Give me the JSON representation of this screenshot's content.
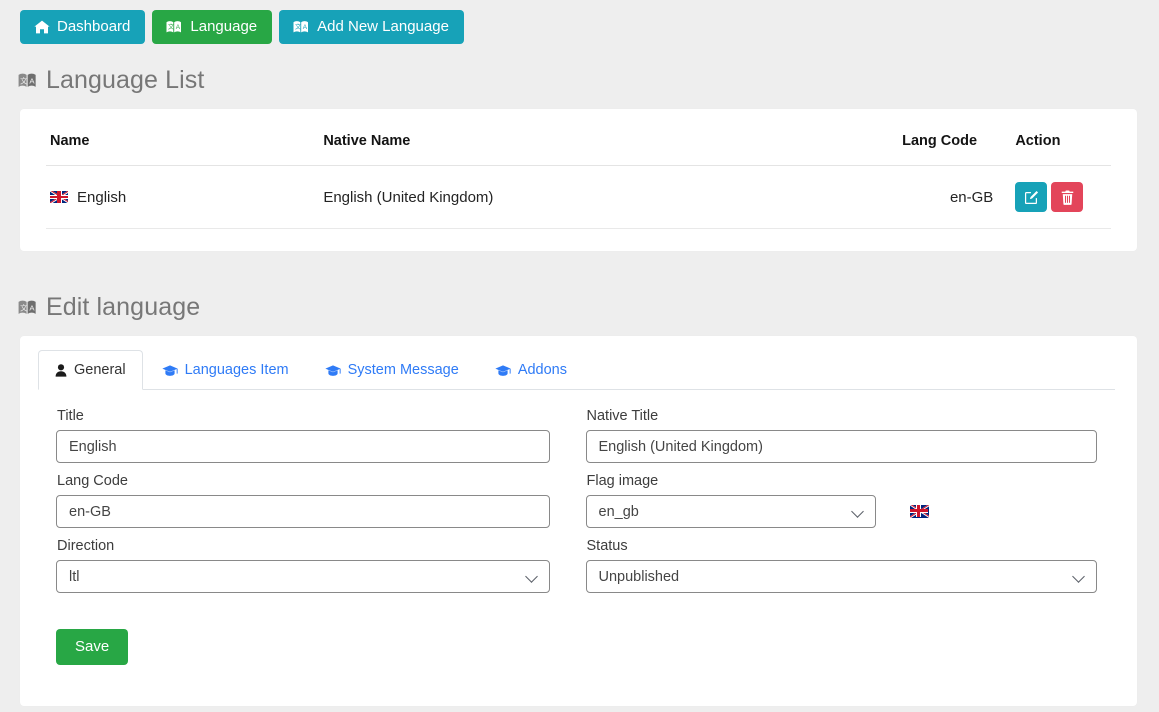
{
  "toolbar": {
    "buttons": [
      {
        "label": "Dashboard",
        "icon": "home-icon",
        "style": "info"
      },
      {
        "label": "Language",
        "icon": "language-book-icon",
        "style": "success"
      },
      {
        "label": "Add New Language",
        "icon": "language-book-icon",
        "style": "info"
      }
    ]
  },
  "list_section": {
    "heading": "Language List",
    "heading_icon": "language-book-icon",
    "table": {
      "columns": [
        "Name",
        "Native Name",
        "Lang Code",
        "Action"
      ],
      "rows": [
        {
          "flag": "uk-flag-icon",
          "name": "English",
          "native_name": "English (United Kingdom)",
          "lang_code": "en-GB",
          "actions": [
            {
              "name": "edit",
              "icon": "edit-pencil-icon",
              "color": "#17a2b8"
            },
            {
              "name": "delete",
              "icon": "trash-icon",
              "color": "#e3455a"
            }
          ]
        }
      ]
    }
  },
  "edit_section": {
    "heading": "Edit language",
    "heading_icon": "language-book-icon",
    "tabs": [
      {
        "label": "General",
        "icon": "user-icon",
        "active": true
      },
      {
        "label": "Languages Item",
        "icon": "graduation-cap-icon",
        "active": false
      },
      {
        "label": "System Message",
        "icon": "graduation-cap-icon",
        "active": false
      },
      {
        "label": "Addons",
        "icon": "graduation-cap-icon",
        "active": false
      }
    ],
    "fields": {
      "title": {
        "label": "Title",
        "value": "English"
      },
      "native_title": {
        "label": "Native Title",
        "value": "English (United Kingdom)"
      },
      "lang_code": {
        "label": "Lang Code",
        "value": "en-GB"
      },
      "flag_image": {
        "label": "Flag image",
        "value": "en_gb",
        "options": [
          "en_gb"
        ],
        "preview_icon": "uk-flag-icon"
      },
      "direction": {
        "label": "Direction",
        "value": "ltl",
        "options": [
          "ltl"
        ]
      },
      "status": {
        "label": "Status",
        "value": "Unpublished",
        "options": [
          "Unpublished"
        ]
      }
    },
    "save_label": "Save"
  },
  "colors": {
    "info": "#17a2b8",
    "success": "#28a745",
    "danger": "#e3455a",
    "link": "#2f7bf6",
    "page_background": "#eeeeee"
  }
}
